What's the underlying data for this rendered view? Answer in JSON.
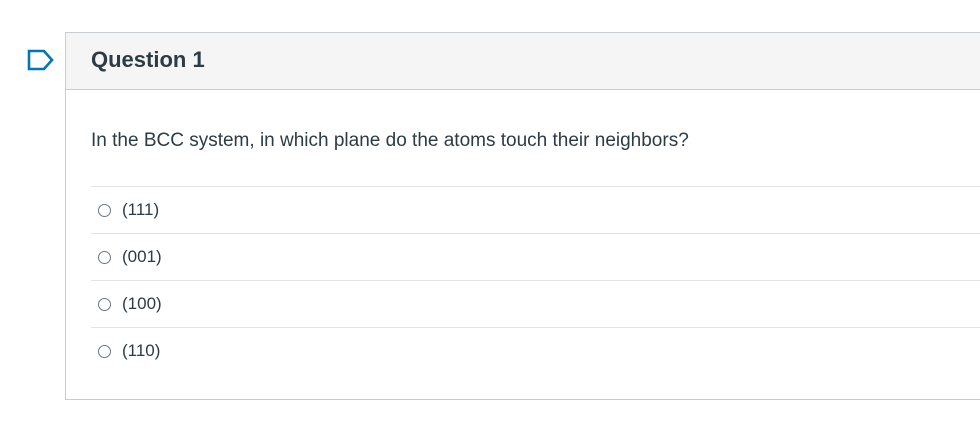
{
  "question": {
    "title": "Question 1",
    "text": "In the BCC system, in which plane do the atoms touch their neighbors?",
    "flag_icon": "flag-question-icon",
    "answers": [
      {
        "label": "(111)",
        "selected": false
      },
      {
        "label": "(001)",
        "selected": false
      },
      {
        "label": "(100)",
        "selected": false
      },
      {
        "label": "(110)",
        "selected": false
      }
    ]
  },
  "colors": {
    "flag": "#0374b5",
    "header_bg": "#f5f5f5",
    "border": "#c7cdd1",
    "text": "#2d3b45"
  }
}
